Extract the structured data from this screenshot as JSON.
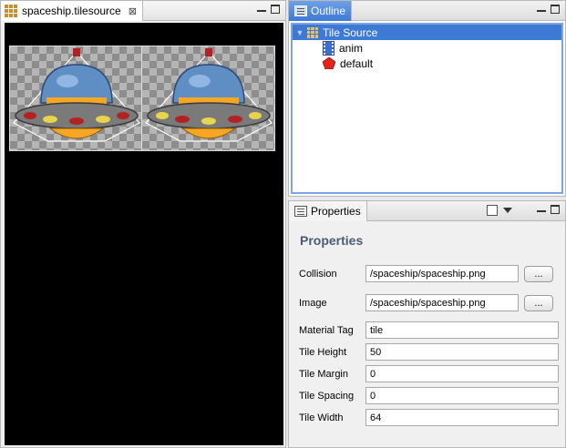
{
  "editor": {
    "tab_label": "spaceship.tilesource",
    "tab_icon": "tilesource-grid-icon",
    "close_glyph": "⊠"
  },
  "outline": {
    "tab_label": "Outline",
    "tree": {
      "root": "Tile Source",
      "children": [
        "anim",
        "default"
      ]
    }
  },
  "properties": {
    "tab_label": "Properties",
    "title": "Properties",
    "browse_label": "...",
    "fields": {
      "collision": {
        "label": "Collision",
        "value": "/spaceship/spaceship.png"
      },
      "image": {
        "label": "Image",
        "value": "/spaceship/spaceship.png"
      },
      "material_tag": {
        "label": "Material Tag",
        "value": "tile"
      },
      "tile_height": {
        "label": "Tile Height",
        "value": "50"
      },
      "tile_margin": {
        "label": "Tile Margin",
        "value": "0"
      },
      "tile_spacing": {
        "label": "Tile Spacing",
        "value": "0"
      },
      "tile_width": {
        "label": "Tile Width",
        "value": "64"
      }
    }
  },
  "colors": {
    "selection": "#3e79d6",
    "canvas": "#000000",
    "ufo_hull": "#7a7a7a",
    "ufo_dome": "#5f8ec4",
    "ufo_band": "#f5a623",
    "ufo_lights_red": "#b22222",
    "ufo_lights_yellow": "#e8d44d"
  }
}
